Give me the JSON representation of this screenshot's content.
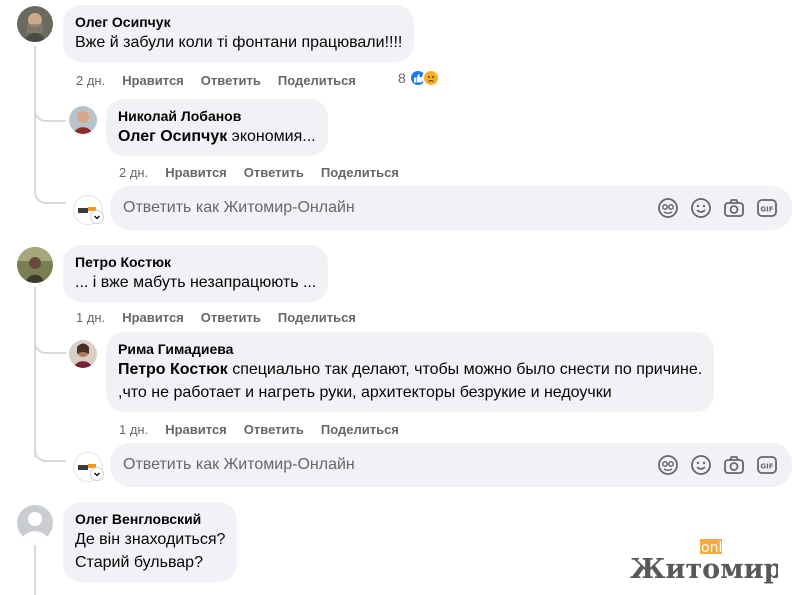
{
  "comments": [
    {
      "author": "Олег Осипчук",
      "text": "Вже й забули коли ті фонтани працювали!!!!",
      "time": "2 дн.",
      "like": "Нравится",
      "reply": "Ответить",
      "share": "Поделиться",
      "reaction_count": "8",
      "reactions": [
        "like-icon",
        "sad-icon"
      ],
      "replies": [
        {
          "author": "Николай Лобанов",
          "mention": "Олег Осипчук",
          "text": " экономия...",
          "time": "2 дн.",
          "like": "Нравится",
          "reply": "Ответить",
          "share": "Поделиться"
        }
      ]
    },
    {
      "author": "Петро Костюк",
      "text": "... і вже мабуть незапрацюють ...",
      "time": "1 дн.",
      "like": "Нравится",
      "reply": "Ответить",
      "share": "Поделиться",
      "replies": [
        {
          "author": "Рима Гимадиева",
          "mention": "Петро Костюк",
          "text_line1": " специально так делают, чтобы можно было снести по причине.",
          "text_line2": ",что не работает и нагреть руки, архитекторы безрукие и недоучки",
          "time": "1 дн.",
          "like": "Нравится",
          "reply": "Ответить",
          "share": "Поделиться"
        }
      ]
    },
    {
      "author": "Олег Венгловский",
      "text_line1": "Де він знаходиться?",
      "text_line2": "Старий бульвар?"
    }
  ],
  "composer": {
    "placeholder": "Ответить как Житомир-Онлайн",
    "icons": [
      "avatar-sticker-icon",
      "emoji-icon",
      "camera-icon",
      "gif-icon"
    ],
    "gif_label": "GIF"
  },
  "watermark": {
    "word": "Житомир",
    "tag": "online"
  },
  "colors": {
    "bubble": "#f0f2f5",
    "meta_text": "#65676b",
    "like_blue": "#1877f2",
    "sad_yellow": "#f7b125",
    "watermark_orange": "#f39a1e"
  }
}
